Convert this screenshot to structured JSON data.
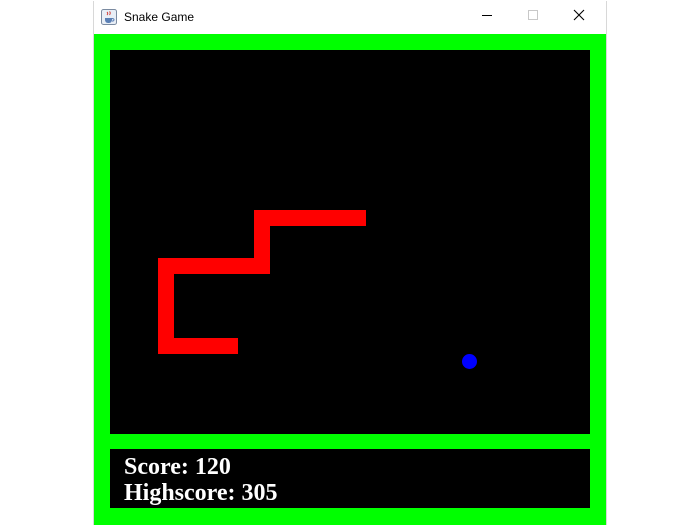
{
  "window": {
    "title": "Snake Game",
    "icon": "java-cup-icon",
    "controls": [
      "minimize-icon",
      "maximize-icon",
      "close-icon"
    ]
  },
  "colors": {
    "border": "#00ff00",
    "board": "#000000",
    "snake": "#ff0000",
    "food": "#0000ff",
    "text": "#ffffff"
  },
  "game": {
    "score_text": "Score: 120",
    "highscore_text": "Highscore: 305"
  }
}
